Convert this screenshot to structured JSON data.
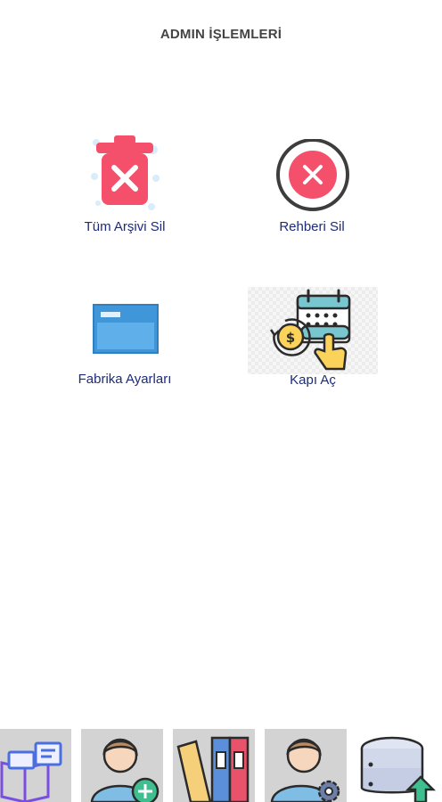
{
  "header": {
    "title": "ADMIN İŞLEMLERİ"
  },
  "tiles": [
    {
      "label": "Tüm Arşivi Sil",
      "icon": "trash-delete-icon"
    },
    {
      "label": "Rehberi Sil",
      "icon": "circle-x-icon"
    },
    {
      "label": "Fabrika Ayarları",
      "icon": "window-icon"
    },
    {
      "label": "Kapı Aç",
      "icon": "calendar-touch-icon"
    }
  ],
  "dock": [
    {
      "icon": "book-messages-icon"
    },
    {
      "icon": "add-user-icon"
    },
    {
      "icon": "binders-icon"
    },
    {
      "icon": "user-settings-icon"
    },
    {
      "icon": "database-upload-icon"
    }
  ],
  "colors": {
    "label_text": "#1d2b7a",
    "title_text": "#444444",
    "danger": "#f4506b",
    "window_blue": "#3f97d9",
    "dock_bg": "#d3d3d3"
  }
}
